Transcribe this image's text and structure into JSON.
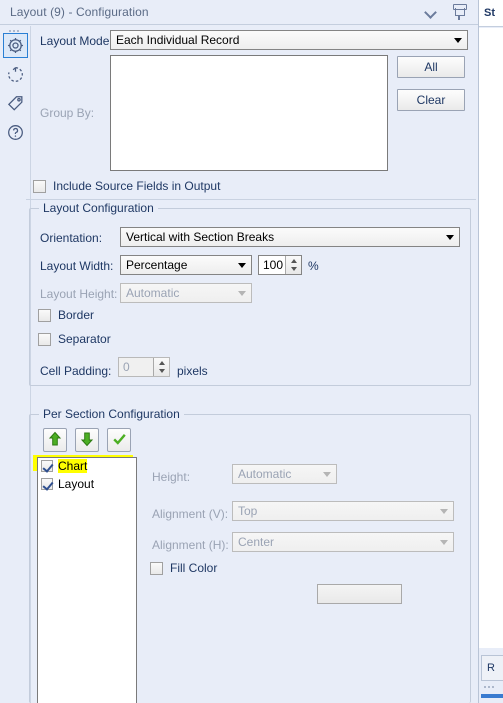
{
  "window": {
    "title": "Layout (9) - Configuration",
    "collapse_icon": "chevron-down-icon",
    "pin_icon": "pin-icon"
  },
  "rail": {
    "items": [
      {
        "icon": "gear-icon",
        "name": "configuration",
        "selected": true
      },
      {
        "icon": "refresh-icon",
        "name": "run",
        "selected": false
      },
      {
        "icon": "tag-icon",
        "name": "annotation",
        "selected": false
      },
      {
        "icon": "help-icon",
        "name": "help",
        "selected": false
      }
    ]
  },
  "top": {
    "layout_mode_label": "Layout Mode:",
    "layout_mode_value": "Each Individual Record",
    "group_by_label": "Group By:",
    "group_by_items": [],
    "all_button": "All",
    "clear_button": "Clear",
    "include_source_fields_label": "Include Source Fields in Output",
    "include_source_fields_checked": false
  },
  "layout_config": {
    "title": "Layout Configuration",
    "orientation_label": "Orientation:",
    "orientation_value": "Vertical with Section Breaks",
    "layout_width_label": "Layout Width:",
    "layout_width_value": "Percentage",
    "layout_width_number": "100",
    "layout_width_unit": "%",
    "layout_height_label": "Layout Height:",
    "layout_height_value": "Automatic",
    "border_label": "Border",
    "border_checked": false,
    "separator_label": "Separator",
    "separator_checked": false,
    "cell_padding_label": "Cell Padding:",
    "cell_padding_value": "0",
    "cell_padding_unit": "pixels"
  },
  "per_section": {
    "title": "Per Section Configuration",
    "toolbar": [
      {
        "name": "move-up-button",
        "icon": "arrow-up-icon"
      },
      {
        "name": "move-down-button",
        "icon": "arrow-down-icon"
      },
      {
        "name": "select-all-button",
        "icon": "check-icon"
      }
    ],
    "sections": [
      {
        "label": "Chart",
        "checked": true,
        "highlighted": true
      },
      {
        "label": "Layout",
        "checked": true,
        "highlighted": false
      }
    ],
    "height_label": "Height:",
    "height_value": "Automatic",
    "align_v_label": "Alignment (V):",
    "align_v_value": "Top",
    "align_h_label": "Alignment (H):",
    "align_h_value": "Center",
    "fill_color_label": "Fill Color",
    "fill_color_checked": false,
    "fill_color_swatch": ""
  },
  "right_panel": {
    "header_text": "St",
    "footer_text": "R"
  },
  "colors": {
    "background": "#e8edf8",
    "accent": "#1f3864",
    "highlight": "#ffff00",
    "green": "#4caf23"
  }
}
